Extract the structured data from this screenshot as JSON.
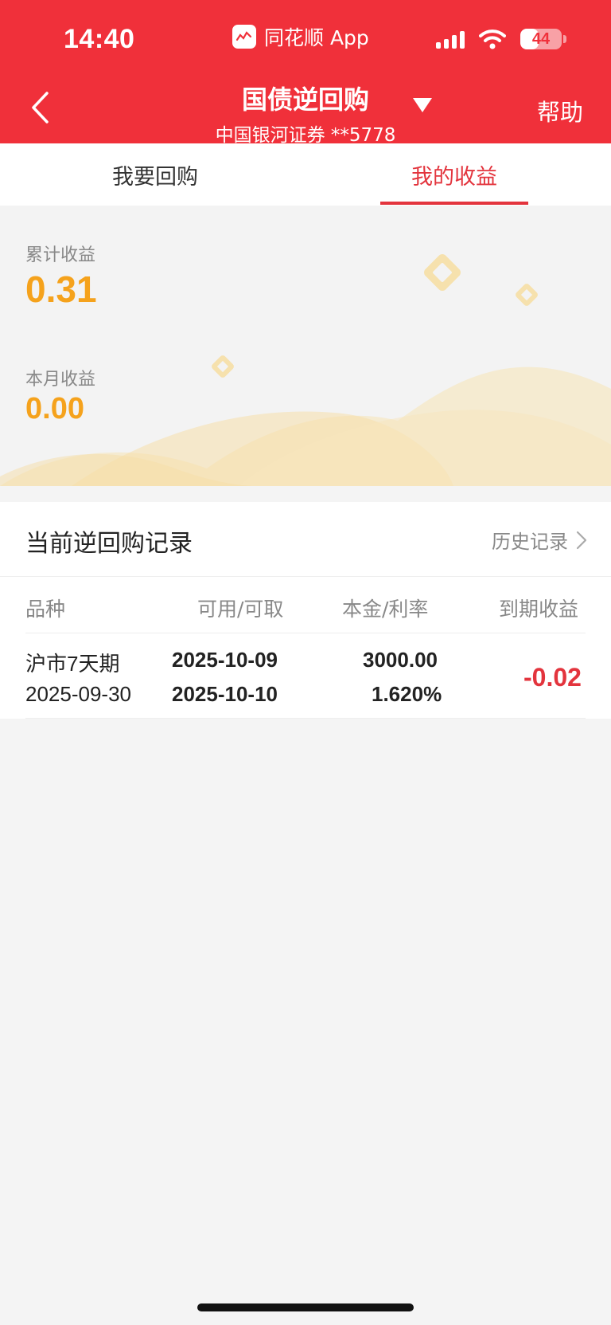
{
  "status_bar": {
    "time": "14:40",
    "app_name": "同花顺 App",
    "battery_level": "44",
    "battery_fraction": 0.44
  },
  "nav": {
    "title": "国债逆回购",
    "subtitle": "中国银河证券 **5778",
    "help_label": "帮助"
  },
  "tabs": [
    {
      "label": "我要回购",
      "active": false
    },
    {
      "label": "我的收益",
      "active": true
    }
  ],
  "earnings": {
    "cumulative_label": "累计收益",
    "cumulative_value": "0.31",
    "monthly_label": "本月收益",
    "monthly_value": "0.00"
  },
  "records": {
    "title": "当前逆回购记录",
    "history_label": "历史记录",
    "columns": [
      "品种",
      "可用/可取",
      "本金/利率",
      "到期收益"
    ],
    "rows": [
      {
        "name": "沪市7天期",
        "date": "2025-09-30",
        "available_date": "2025-10-09",
        "withdraw_date": "2025-10-10",
        "principal": "3000.00",
        "rate": "1.620%",
        "expected_profit": "-0.02"
      }
    ]
  },
  "colors": {
    "brand_red": "#f0303a",
    "accent_red": "#e3343d",
    "earnings_orange": "#f5a21c"
  }
}
